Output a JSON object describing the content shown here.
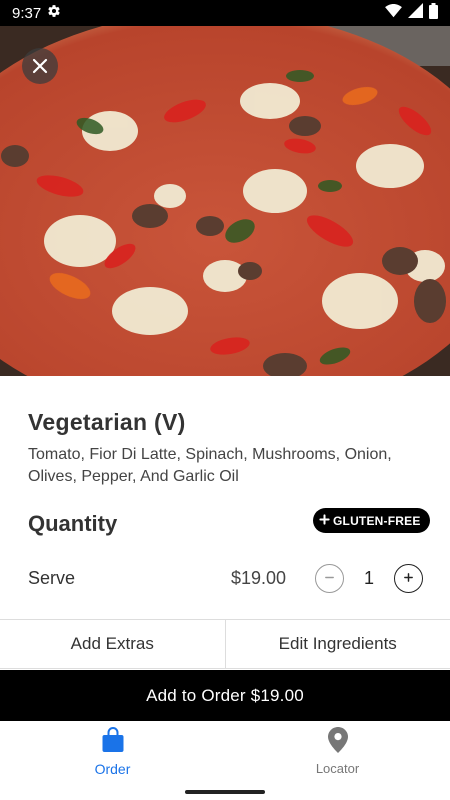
{
  "status_bar": {
    "time": "9:37",
    "icons": [
      "settings-icon",
      "wifi-icon",
      "signal-icon",
      "battery-icon"
    ]
  },
  "hero": {
    "image_subject": "pizza-photo"
  },
  "item": {
    "title": "Vegetarian (V)",
    "description": "Tomato, Fior Di Latte, Spinach, Mushrooms, Onion, Olives, Pepper, And Garlic Oil"
  },
  "quantity": {
    "heading": "Quantity",
    "badge": "GLUTEN-FREE",
    "serve_label": "Serve",
    "price": "$19.00",
    "count": "1"
  },
  "actions": {
    "add_extras": "Add Extras",
    "edit_ingredients": "Edit Ingredients"
  },
  "order_button": "Add to Order $19.00",
  "nav": {
    "items": [
      {
        "label": "Order",
        "icon": "shopping-bag-icon",
        "active": true
      },
      {
        "label": "Locator",
        "icon": "location-pin-icon",
        "active": false
      }
    ]
  },
  "colors": {
    "accent": "#1a73e8",
    "primary_button": "#000000",
    "badge": "#000000"
  }
}
